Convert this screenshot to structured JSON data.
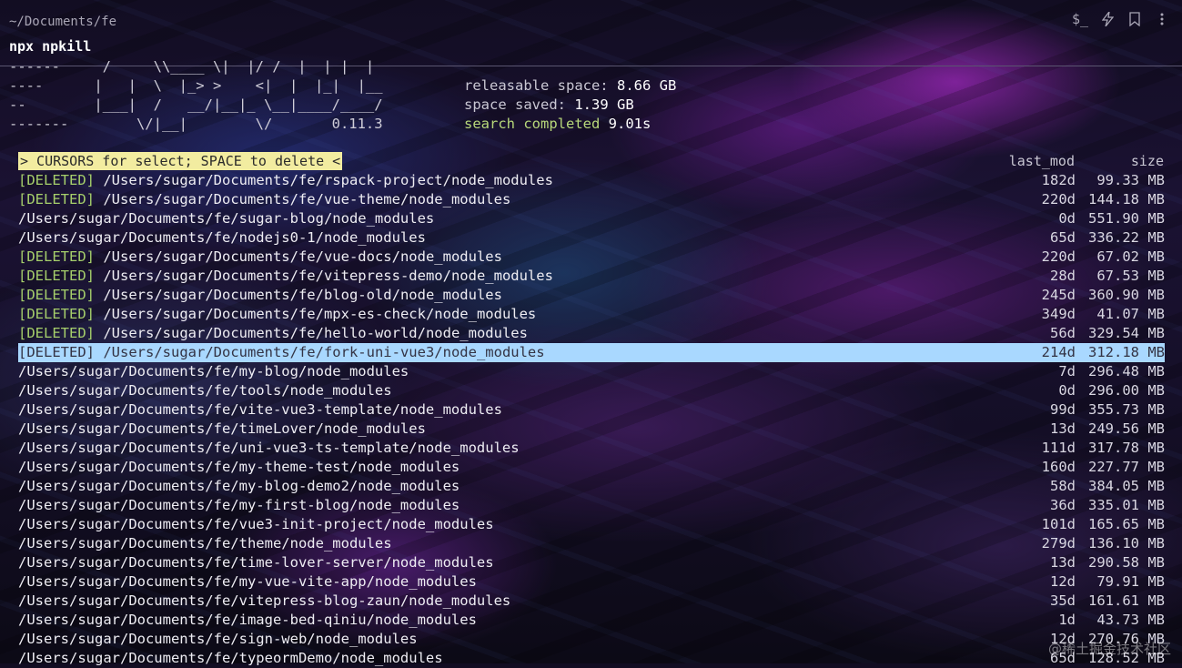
{
  "terminal": {
    "cwd": "~/Documents/fe",
    "command": "npx npkill",
    "icons": [
      "dollar-prompt-icon",
      "lightning-icon",
      "bookmark-icon",
      "more-vertical-icon"
    ]
  },
  "banner": {
    "lines": [
      "------     /     \\\\____ \\|  |/ /  |  | |  |",
      "----      |   |  \\  |_> >    <|  |  |_|  |__",
      "--        |___|  /   __/|__|_ \\__|____/____/",
      "-------        \\/|__|        \\/       0.11.3"
    ]
  },
  "stats": {
    "releasable_label": "releasable space:",
    "releasable_value": "8.66 GB",
    "saved_label": "space saved:",
    "saved_value": "1.39 GB",
    "status_label": "search completed",
    "status_time": "9.01s"
  },
  "prompt": "> CURSORS for select; SPACE to delete <",
  "columns": {
    "last_mod": "last_mod",
    "size": "size"
  },
  "deleted_tag": "[DELETED]",
  "results": [
    {
      "deleted": true,
      "path": "/Users/sugar/Documents/fe/rspack-project/node_modules",
      "last_mod": "182d",
      "size": "99.33 MB"
    },
    {
      "deleted": true,
      "path": "/Users/sugar/Documents/fe/vue-theme/node_modules",
      "last_mod": "220d",
      "size": "144.18 MB"
    },
    {
      "deleted": false,
      "path": "/Users/sugar/Documents/fe/sugar-blog/node_modules",
      "last_mod": "0d",
      "size": "551.90 MB"
    },
    {
      "deleted": false,
      "path": "/Users/sugar/Documents/fe/nodejs0-1/node_modules",
      "last_mod": "65d",
      "size": "336.22 MB"
    },
    {
      "deleted": true,
      "path": "/Users/sugar/Documents/fe/vue-docs/node_modules",
      "last_mod": "220d",
      "size": "67.02 MB"
    },
    {
      "deleted": true,
      "path": "/Users/sugar/Documents/fe/vitepress-demo/node_modules",
      "last_mod": "28d",
      "size": "67.53 MB"
    },
    {
      "deleted": true,
      "path": "/Users/sugar/Documents/fe/blog-old/node_modules",
      "last_mod": "245d",
      "size": "360.90 MB"
    },
    {
      "deleted": true,
      "path": "/Users/sugar/Documents/fe/mpx-es-check/node_modules",
      "last_mod": "349d",
      "size": "41.07 MB"
    },
    {
      "deleted": true,
      "path": "/Users/sugar/Documents/fe/hello-world/node_modules",
      "last_mod": "56d",
      "size": "329.54 MB"
    },
    {
      "deleted": true,
      "path": "/Users/sugar/Documents/fe/fork-uni-vue3/node_modules",
      "last_mod": "214d",
      "size": "312.18 MB",
      "selected": true
    },
    {
      "deleted": false,
      "path": "/Users/sugar/Documents/fe/my-blog/node_modules",
      "last_mod": "7d",
      "size": "296.48 MB"
    },
    {
      "deleted": false,
      "path": "/Users/sugar/Documents/fe/tools/node_modules",
      "last_mod": "0d",
      "size": "296.00 MB"
    },
    {
      "deleted": false,
      "path": "/Users/sugar/Documents/fe/vite-vue3-template/node_modules",
      "last_mod": "99d",
      "size": "355.73 MB"
    },
    {
      "deleted": false,
      "path": "/Users/sugar/Documents/fe/timeLover/node_modules",
      "last_mod": "13d",
      "size": "249.56 MB"
    },
    {
      "deleted": false,
      "path": "/Users/sugar/Documents/fe/uni-vue3-ts-template/node_modules",
      "last_mod": "111d",
      "size": "317.78 MB"
    },
    {
      "deleted": false,
      "path": "/Users/sugar/Documents/fe/my-theme-test/node_modules",
      "last_mod": "160d",
      "size": "227.77 MB"
    },
    {
      "deleted": false,
      "path": "/Users/sugar/Documents/fe/my-blog-demo2/node_modules",
      "last_mod": "58d",
      "size": "384.05 MB"
    },
    {
      "deleted": false,
      "path": "/Users/sugar/Documents/fe/my-first-blog/node_modules",
      "last_mod": "36d",
      "size": "335.01 MB"
    },
    {
      "deleted": false,
      "path": "/Users/sugar/Documents/fe/vue3-init-project/node_modules",
      "last_mod": "101d",
      "size": "165.65 MB"
    },
    {
      "deleted": false,
      "path": "/Users/sugar/Documents/fe/theme/node_modules",
      "last_mod": "279d",
      "size": "136.10 MB"
    },
    {
      "deleted": false,
      "path": "/Users/sugar/Documents/fe/time-lover-server/node_modules",
      "last_mod": "13d",
      "size": "290.58 MB"
    },
    {
      "deleted": false,
      "path": "/Users/sugar/Documents/fe/my-vue-vite-app/node_modules",
      "last_mod": "12d",
      "size": "79.91 MB"
    },
    {
      "deleted": false,
      "path": "/Users/sugar/Documents/fe/vitepress-blog-zaun/node_modules",
      "last_mod": "35d",
      "size": "161.61 MB"
    },
    {
      "deleted": false,
      "path": "/Users/sugar/Documents/fe/image-bed-qiniu/node_modules",
      "last_mod": "1d",
      "size": "43.73 MB"
    },
    {
      "deleted": false,
      "path": "/Users/sugar/Documents/fe/sign-web/node_modules",
      "last_mod": "12d",
      "size": "270.76 MB"
    },
    {
      "deleted": false,
      "path": "/Users/sugar/Documents/fe/typeormDemo/node_modules",
      "last_mod": "65d",
      "size": "128.52 MB"
    }
  ],
  "watermark": "@稀土掘金技术社区",
  "colors": {
    "deleted_tag": "#a6cf6b",
    "selected_row": "#a9d8ff",
    "prompt_bg": "#f2eca0",
    "status_green": "#b7d77a"
  }
}
